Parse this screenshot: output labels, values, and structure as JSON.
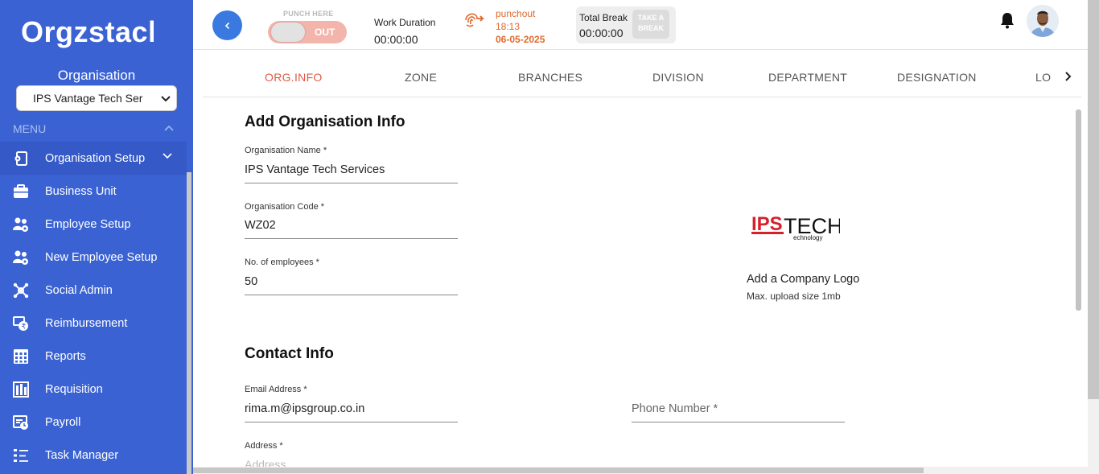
{
  "app": {
    "logo_text": "Orgzstack"
  },
  "sidebar": {
    "org_label": "Organisation",
    "org_select_value": "IPS Vantage Tech Ser",
    "menu_header": "MENU",
    "items": [
      {
        "label": "Organisation Setup",
        "icon": "org-setup-icon"
      },
      {
        "label": "Business Unit",
        "icon": "briefcase-icon"
      },
      {
        "label": "Employee Setup",
        "icon": "users-gear-icon"
      },
      {
        "label": "New Employee Setup",
        "icon": "users-gear-icon"
      },
      {
        "label": "Social Admin",
        "icon": "social-icon"
      },
      {
        "label": "Reimbursement",
        "icon": "reimbursement-icon"
      },
      {
        "label": "Reports",
        "icon": "reports-icon"
      },
      {
        "label": "Requisition",
        "icon": "requisition-icon"
      },
      {
        "label": "Payroll",
        "icon": "payroll-icon"
      },
      {
        "label": "Task Manager",
        "icon": "task-icon"
      }
    ]
  },
  "topbar": {
    "punch_label": "PUNCH HERE",
    "punch_toggle_text": "OUT",
    "work_duration_label": "Work Duration",
    "work_duration_value": "00:00:00",
    "punch_status": "punchout",
    "punch_time": "18:13",
    "punch_date": "06-05-2025",
    "total_break_label": "Total Break",
    "total_break_value": "00:00:00",
    "take_break_line1": "TAKE A",
    "take_break_line2": "BREAK"
  },
  "tabs": [
    "ORG.INFO",
    "ZONE",
    "BRANCHES",
    "DIVISION",
    "DEPARTMENT",
    "DESIGNATION",
    "LO"
  ],
  "form": {
    "org_section_title": "Add Organisation Info",
    "org_name_label": "Organisation Name *",
    "org_name_value": "IPS Vantage Tech Services",
    "org_code_label": "Organisation Code *",
    "org_code_value": "WZ02",
    "employees_label": "No. of employees *",
    "employees_value": "50",
    "logo_caption": "Add a Company Logo",
    "logo_subcaption": "Max. upload size 1mb",
    "logo_text_ips": "IPS",
    "logo_text_tech": "TECH",
    "logo_text_technology": "echnology",
    "contact_section_title": "Contact Info",
    "email_label": "Email Address *",
    "email_value": "rima.m@ipsgroup.co.in",
    "phone_placeholder": "Phone Number *",
    "address_label": "Address *",
    "address_placeholder": "Address"
  },
  "colors": {
    "sidebar_bg": "#3a62d3",
    "accent_red": "#e05a45",
    "punch_orange": "#e06a2c",
    "back_button": "#3a7ae0"
  }
}
